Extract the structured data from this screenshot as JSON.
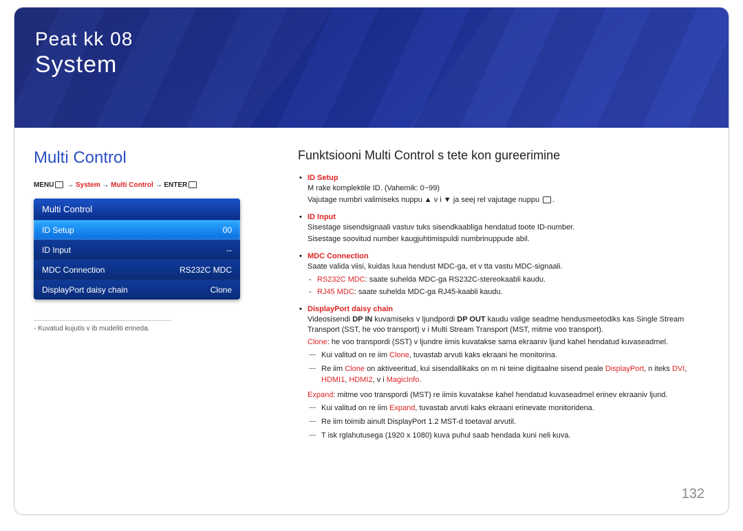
{
  "hero": {
    "chapter": "Peat kk  08",
    "title": "System"
  },
  "left": {
    "section_title": "Multi Control",
    "breadcrumb": {
      "prefix": "MENU",
      "p1": "System",
      "p2": "Multi Control",
      "suffix": "ENTER"
    },
    "osd": {
      "header": "Multi Control",
      "rows": [
        {
          "label": "ID Setup",
          "value": "00",
          "selected": true
        },
        {
          "label": "ID Input",
          "value": "--",
          "selected": false
        },
        {
          "label": "MDC Connection",
          "value": "RS232C MDC",
          "selected": false
        },
        {
          "label": "DisplayPort daisy chain",
          "value": "Clone",
          "selected": false
        }
      ]
    },
    "footnote": "Kuvatud kujutis v ib mudeliti erineda."
  },
  "right": {
    "heading": "Funktsiooni Multi Control s tete kon gureerimine",
    "items": {
      "idsetup": {
        "label": "ID Setup",
        "l1": "M  rake komplektile ID. (Vahemik: 0~99)",
        "l2": "Vajutage numbri valimiseks nuppu ▲ v i ▼ ja seej rel vajutage nuppu "
      },
      "idinput": {
        "label": "ID Input",
        "l1": "Sisestage sisendsignaali vastuv tuks sisendkaabliga  hendatud toote ID-number.",
        "l2": "Sisestage soovitud number kaugjuhtimispuldi numbrinuppude abil."
      },
      "mdc": {
        "label": "MDC Connection",
        "l1": "Saate valida viisi, kuidas luua  hendust MDC-ga, et v tta vastu MDC-signaali.",
        "sub1_label": "RS232C MDC",
        "sub1_text": ": saate suhelda MDC-ga RS232C-stereokaabli kaudu.",
        "sub2_label": "RJ45 MDC",
        "sub2_text": ": saate suhelda MDC-ga RJ45-kaabli kaudu."
      },
      "dp": {
        "label": "DisplayPort daisy chain",
        "intro_a": "Videosisendi ",
        "intro_b": "DP IN",
        "intro_c": " kuvamiseks v ljundpordi ",
        "intro_d": "DP OUT",
        "intro_e": " kaudu valige seadme  hendusmeetodiks kas Single Stream Transport (SST,  he voo transport) v i Multi Stream Transport (MST, mitme voo transport).",
        "clone_label": "Clone",
        "clone_text": ":  he voo transpordi (SST) v ljundre iimis kuvatakse sama ekraaniv ljund kahel  hendatud kuvaseadmel.",
        "d1a": "Kui valitud on re iim ",
        "d1b": "Clone",
        "d1c": ", tuvastab arvuti kaks ekraani  he monitorina.",
        "d2a": "Re iim ",
        "d2b": "Clone",
        "d2c": " on aktiveeritud, kui sisendallikaks on m ni teine digitaalne sisend peale ",
        "d2d": "DisplayPort",
        "d2e": ", n iteks ",
        "d2f": "DVI",
        "d2g": ", ",
        "d2h": "HDMI1",
        "d2i": ", ",
        "d2j": "HDMI2",
        "d2k": ", v i ",
        "d2l": "MagicInfo",
        "d2m": ".",
        "expand_label": "Expand",
        "expand_text": ": mitme voo transpordi (MST) re iimis kuvatakse kahel  hendatud kuvaseadmel erinev ekraaniv ljund.",
        "d3a": "Kui valitud on re iim ",
        "d3b": "Expand",
        "d3c": ", tuvastab arvuti kaks ekraani erinevate monitoridena.",
        "d4": "Re iim toimib ainult DisplayPort 1.2 MST-d toetaval arvutil.",
        "d5": "T isk rglahutusega (1920 x 1080) kuva puhul saab  hendada kuni neli kuva."
      }
    }
  },
  "page_number": "132"
}
